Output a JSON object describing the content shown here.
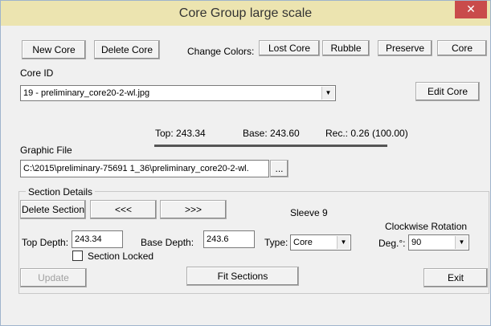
{
  "window": {
    "title": "Core Group large scale",
    "close_glyph": "✕"
  },
  "toolbar": {
    "new_core": "New Core",
    "delete_core": "Delete Core",
    "change_colors_label": "Change Colors:",
    "lost_core": "Lost Core",
    "rubble": "Rubble",
    "preserve": "Preserve",
    "core": "Core"
  },
  "core_id": {
    "label": "Core ID",
    "value": "19 - preliminary_core20-2-wl.jpg",
    "edit_button": "Edit Core"
  },
  "summary": {
    "top": "Top: 243.34",
    "base": "Base: 243.60",
    "rec": "Rec.: 0.26 (100.00)"
  },
  "graphic_file": {
    "label": "Graphic File",
    "value": "C:\\2015\\preliminary-75691 1_36\\preliminary_core20-2-wl.",
    "browse_button": "..."
  },
  "section": {
    "title": "Section Details",
    "delete_section": "Delete Section",
    "prev_button": "<<<",
    "next_button": ">>>",
    "sleeve": "Sleeve 9",
    "clockwise_label": "Clockwise Rotation",
    "top_depth_label": "Top Depth:",
    "top_depth_value": "243.34",
    "base_depth_label": "Base Depth:",
    "base_depth_value": "243.6",
    "type_label": "Type:",
    "type_value": "Core",
    "deg_label": "Deg.°:",
    "deg_value": "90",
    "locked_label": "Section Locked",
    "locked_checked": false
  },
  "footer": {
    "update": "Update",
    "fit_sections": "Fit Sections",
    "exit": "Exit"
  },
  "colors": {
    "titlebar": "#ece4b0",
    "close": "#c94b4b",
    "background": "#f0f0f0"
  },
  "icons": {
    "dropdown": "chevron-down-icon",
    "close": "close-icon"
  }
}
